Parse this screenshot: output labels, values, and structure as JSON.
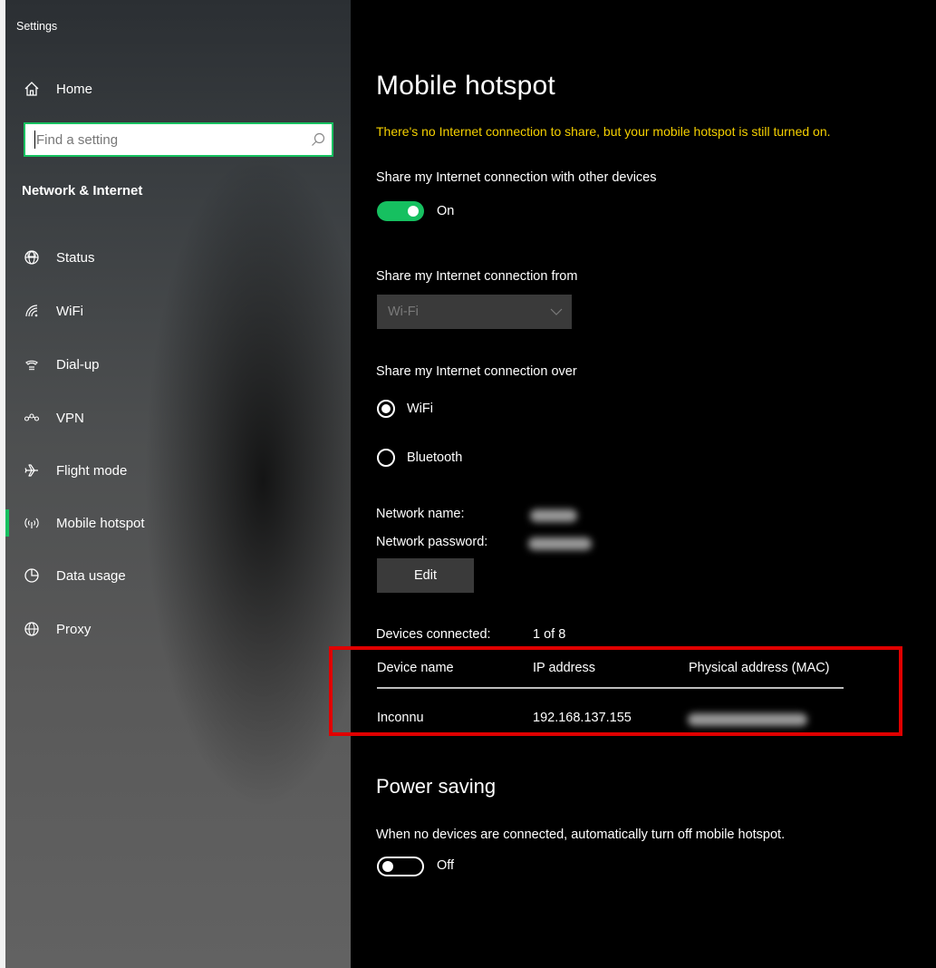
{
  "window": {
    "title": "Settings"
  },
  "sidebar": {
    "home_label": "Home",
    "search_placeholder": "Find a setting",
    "section_title": "Network & Internet",
    "items": [
      {
        "label": "Status",
        "icon": "globe-status-icon"
      },
      {
        "label": "WiFi",
        "icon": "wifi-icon"
      },
      {
        "label": "Dial-up",
        "icon": "dial-up-icon"
      },
      {
        "label": "VPN",
        "icon": "vpn-icon"
      },
      {
        "label": "Flight mode",
        "icon": "airplane-icon"
      },
      {
        "label": "Mobile hotspot",
        "icon": "hotspot-icon",
        "active": true
      },
      {
        "label": "Data usage",
        "icon": "data-usage-icon"
      },
      {
        "label": "Proxy",
        "icon": "globe-icon"
      }
    ],
    "accent_color": "#16c060"
  },
  "main": {
    "title": "Mobile hotspot",
    "warning": "There's no Internet connection to share, but your mobile hotspot is still turned on.",
    "share_label": "Share my Internet connection with other devices",
    "share_toggle": {
      "state": "On",
      "on": true
    },
    "share_from_label": "Share my Internet connection from",
    "share_from_value": "Wi-Fi",
    "share_over_label": "Share my Internet connection over",
    "share_over_options": [
      {
        "label": "WiFi",
        "selected": true
      },
      {
        "label": "Bluetooth",
        "selected": false
      }
    ],
    "network_name_label": "Network name:",
    "network_password_label": "Network password:",
    "edit_label": "Edit",
    "devices_connected_label": "Devices connected:",
    "devices_connected_value": "1 of 8",
    "table": {
      "headers": [
        "Device name",
        "IP address",
        "Physical address (MAC)"
      ],
      "rows": [
        {
          "device": "Inconnu",
          "ip": "192.168.137.155"
        }
      ]
    },
    "power_saving_title": "Power saving",
    "power_saving_desc": "When no devices are connected, automatically turn off mobile hotspot.",
    "power_toggle": {
      "state": "Off",
      "on": false
    },
    "warning_color": "#f5d000",
    "highlight_color": "#e00000"
  }
}
